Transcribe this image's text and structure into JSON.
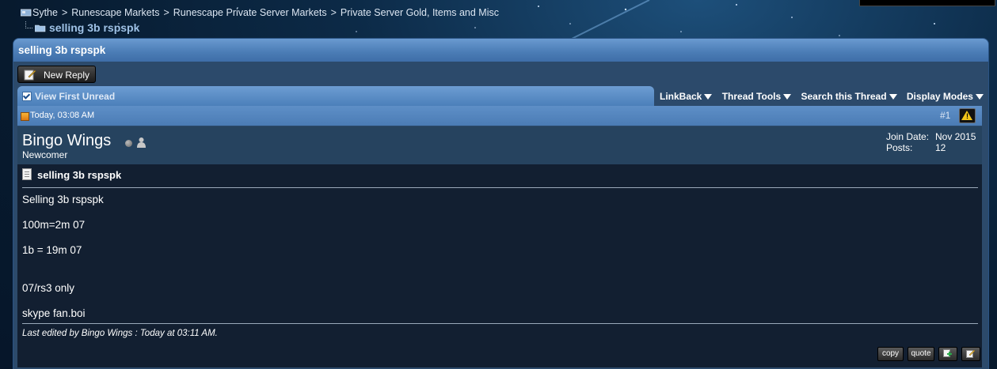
{
  "breadcrumb": {
    "items": [
      "Sythe",
      "Runescape Markets",
      "Runescape Private Server Markets",
      "Private Server Gold, Items and Misc"
    ],
    "current": "selling 3b rspspk"
  },
  "thread": {
    "title": "selling 3b rspspk"
  },
  "toolbar": {
    "new_reply_label": "New Reply",
    "view_first_unread": "View First Unread",
    "menus": [
      "LinkBack",
      "Thread Tools",
      "Search this Thread",
      "Display Modes"
    ]
  },
  "post": {
    "date": "Today, 03:08 AM",
    "number": "#1",
    "author": {
      "name": "Bingo Wings",
      "title": "Newcomer",
      "join_date_label": "Join Date:",
      "join_date": "Nov 2015",
      "posts_label": "Posts:",
      "posts": "12"
    },
    "title": "selling 3b rspspk",
    "lines": [
      "Selling 3b rspspk",
      "100m=2m 07",
      "1b = 19m 07",
      "07/rs3 only",
      "skype fan.boi"
    ],
    "edited_note": "Last edited by Bingo Wings : Today at 03:11 AM.",
    "buttons": {
      "copy": "copy",
      "quote": "quote"
    }
  },
  "icons": [
    "home-icon",
    "folder-icon",
    "new-reply-icon",
    "checkbox-icon",
    "dropdown-arrow-icon",
    "post-icon",
    "warning-icon",
    "offline-status-icon",
    "user-icon",
    "document-icon",
    "multiquote-icon",
    "edit-icon"
  ],
  "colors": {
    "header_blue": "#4a7cb5",
    "post_body": "#121f31",
    "user_bar": "#26435f"
  }
}
